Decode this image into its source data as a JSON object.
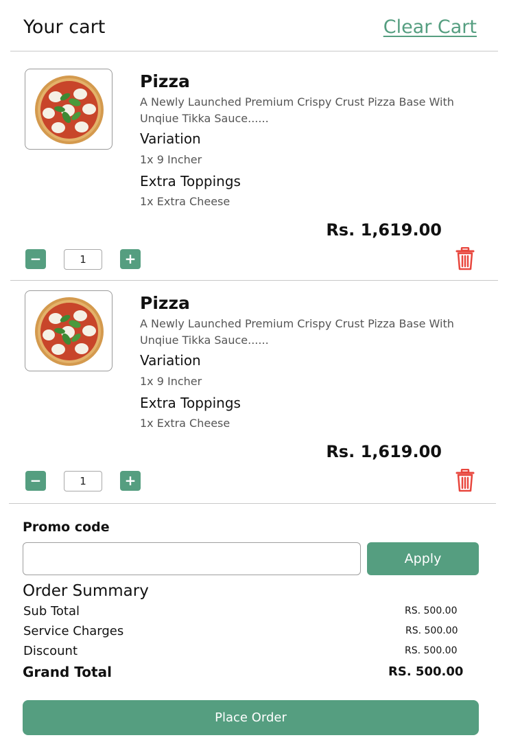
{
  "header": {
    "title": "Your cart",
    "clear_label": "Clear Cart"
  },
  "items": [
    {
      "name": "Pizza",
      "description": "A Newly Launched Premium Crispy Crust Pizza Base With Unqiue Tikka Sauce......",
      "variation_label": "Variation",
      "variation_value": "1x 9 Incher",
      "toppings_label": "Extra Toppings",
      "toppings_value": "1x Extra Cheese",
      "price": "Rs. 1,619.00",
      "quantity": "1",
      "minus_label": "−",
      "plus_label": "+"
    },
    {
      "name": "Pizza",
      "description": "A Newly Launched Premium Crispy Crust Pizza Base With Unqiue Tikka Sauce......",
      "variation_label": "Variation",
      "variation_value": "1x 9 Incher",
      "toppings_label": "Extra Toppings",
      "toppings_value": "1x Extra Cheese",
      "price": "Rs. 1,619.00",
      "quantity": "1",
      "minus_label": "−",
      "plus_label": "+"
    }
  ],
  "promo": {
    "label": "Promo code",
    "value": "",
    "apply_label": "Apply"
  },
  "summary": {
    "title": "Order Summary",
    "sub_total_label": "Sub Total",
    "sub_total_value": "RS. 500.00",
    "service_label": "Service Charges",
    "service_value": "RS. 500.00",
    "discount_label": "Discount",
    "discount_value": "RS. 500.00",
    "grand_label": "Grand Total",
    "grand_value": "RS. 500.00"
  },
  "place_order_label": "Place Order",
  "colors": {
    "accent": "#559e80",
    "danger": "#e8463d",
    "divider": "#c8c8c8"
  },
  "icons": {
    "product": "pizza-image",
    "delete": "trash-icon"
  }
}
